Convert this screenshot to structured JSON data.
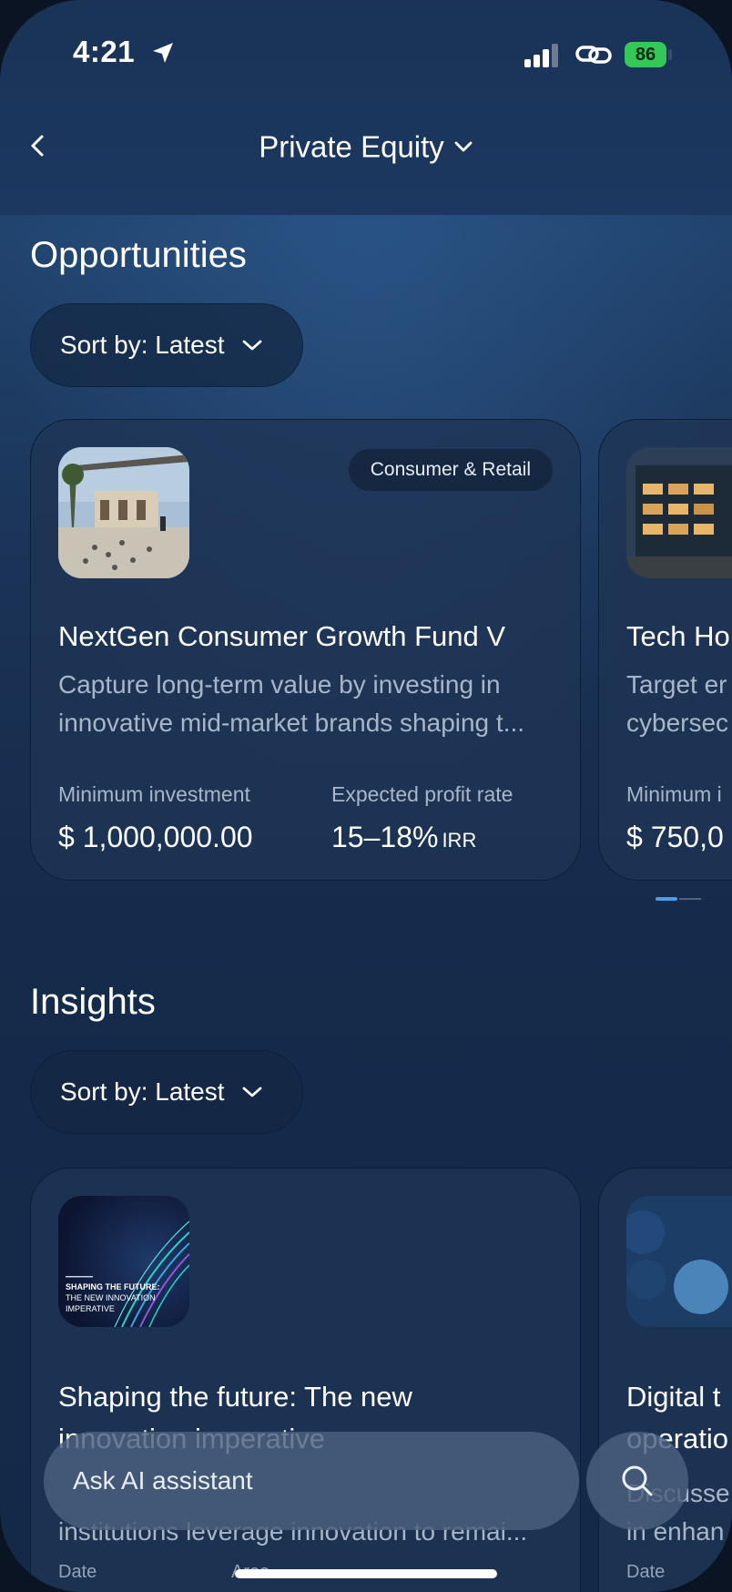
{
  "status_bar": {
    "time": "4:21",
    "battery": "86"
  },
  "nav": {
    "title": "Private Equity"
  },
  "opportunities": {
    "title": "Opportunities",
    "sort_label": "Sort by: Latest",
    "cards": [
      {
        "tag": "Consumer & Retail",
        "title": "NextGen Consumer Growth Fund V",
        "desc_line1": "Capture long-term value by investing in",
        "desc_line2": "innovative mid-market brands shaping t...",
        "min_label": "Minimum investment",
        "min_value": "$ 1,000,000.00",
        "rate_label": "Expected profit rate",
        "rate_value": "15–18%",
        "rate_unit": "IRR"
      },
      {
        "title": "Tech Ho",
        "desc_line1": "Target er",
        "desc_line2": "cybersec",
        "min_label": "Minimum i",
        "min_value": "$ 750,0"
      }
    ]
  },
  "insights": {
    "title": "Insights",
    "sort_label": "Sort by: Latest",
    "cards": [
      {
        "thumb_line1": "SHAPING THE FUTURE:",
        "thumb_line2": "THE NEW INNOVATION",
        "thumb_line3": "IMPERATIVE",
        "title_line1": "Shaping the future: The new",
        "title_line2": "innovation imperative",
        "desc_line2": "institutions leverage innovation to remai...",
        "date_label": "Date",
        "area_label": "Area"
      },
      {
        "title_line1": "Digital t",
        "title_line2": "operatio",
        "desc_line1": "Discusse",
        "desc_line2": "in enhan",
        "date_label": "Date"
      }
    ]
  },
  "assistant": {
    "placeholder": "Ask AI assistant"
  },
  "colors": {
    "accent": "#4c9fe3",
    "battery": "#34c759",
    "background": "#1e3a63"
  }
}
